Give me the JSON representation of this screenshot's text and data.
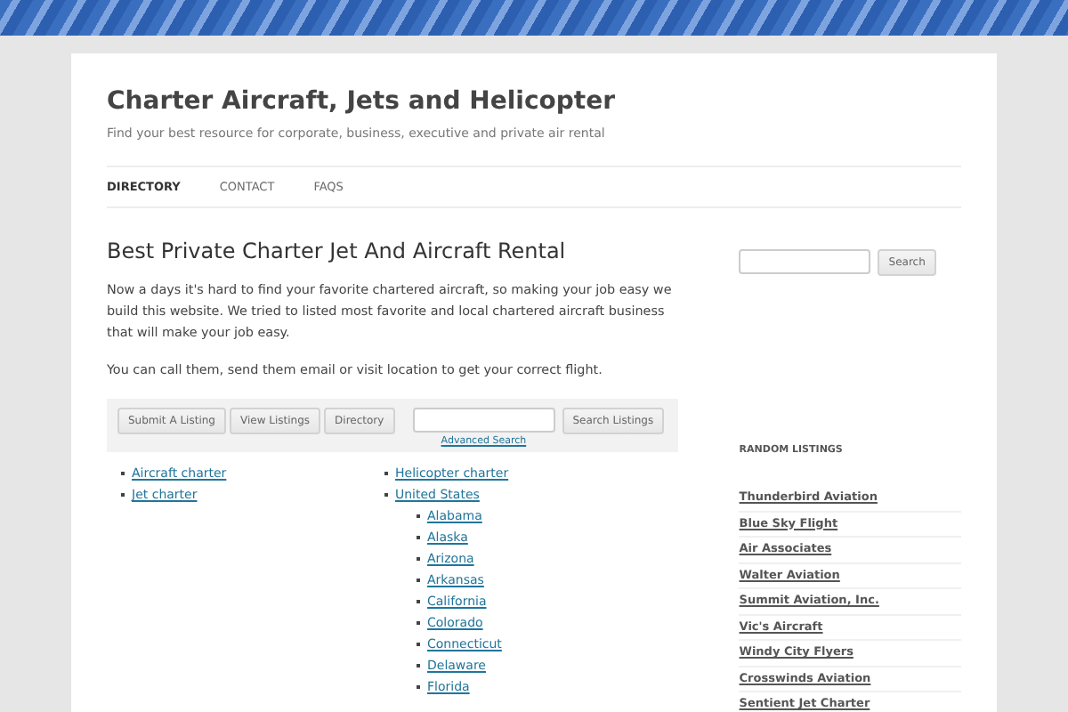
{
  "site": {
    "title": "Charter Aircraft, Jets and Helicopter",
    "tagline": "Find your best resource for corporate, business, executive and private air rental"
  },
  "nav": [
    {
      "label": "DIRECTORY",
      "selected": true
    },
    {
      "label": "CONTACT",
      "selected": false
    },
    {
      "label": "FAQS",
      "selected": false
    }
  ],
  "article": {
    "title": "Best Private Charter Jet And Aircraft Rental",
    "paragraphs": [
      "Now a days it's hard to find your favorite chartered aircraft, so making your job easy we build this website. We tried to listed most favorite and local chartered aircraft business that will make your job easy.",
      "You can call them, send them email or visit location to get your correct flight."
    ]
  },
  "directory_bar": {
    "buttons": [
      "Submit A Listing",
      "View Listings",
      "Directory"
    ],
    "search_button": "Search Listings",
    "advanced_link": "Advanced Search"
  },
  "categories": [
    [
      {
        "label": "Aircraft charter"
      },
      {
        "label": "Jet charter"
      }
    ],
    [
      {
        "label": "Helicopter charter"
      },
      {
        "label": "United States",
        "children": [
          {
            "label": "Alabama"
          },
          {
            "label": "Alaska"
          },
          {
            "label": "Arizona"
          },
          {
            "label": "Arkansas"
          },
          {
            "label": "California"
          },
          {
            "label": "Colorado"
          },
          {
            "label": "Connecticut"
          },
          {
            "label": "Delaware"
          },
          {
            "label": "Florida"
          }
        ]
      }
    ]
  ],
  "sidebar": {
    "search_button": "Search",
    "widget_title": "RANDOM LISTINGS",
    "listings": [
      "Thunderbird Aviation",
      "Blue Sky Flight",
      "Air Associates",
      "Walter Aviation",
      "Summit Aviation, Inc.",
      "Vic's Aircraft",
      "Windy City Flyers",
      "Crosswinds Aviation",
      "Sentient Jet Charter"
    ]
  }
}
